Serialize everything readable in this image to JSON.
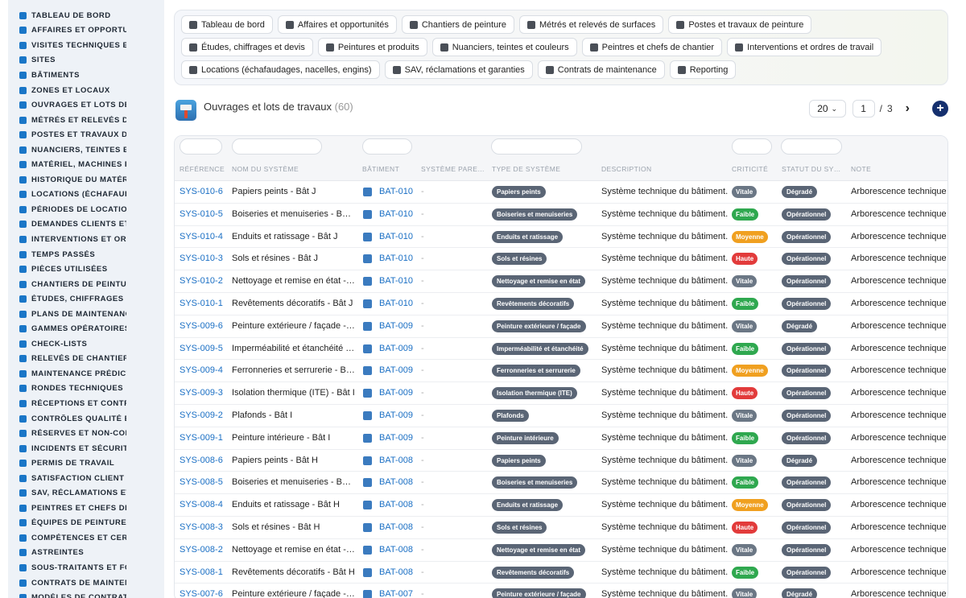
{
  "sidebar": {
    "items": [
      {
        "label": "TABLEAU DE BORD",
        "icon": "dashboard-icon"
      },
      {
        "label": "AFFAIRES ET OPPORTUNITÉS",
        "icon": "target-icon"
      },
      {
        "label": "VISITES TECHNIQUES ET",
        "icon": "clipboard-icon"
      },
      {
        "label": "SITES",
        "icon": "map-pin-icon"
      },
      {
        "label": "BÂTIMENTS",
        "icon": "building-icon"
      },
      {
        "label": "ZONES ET LOCAUX",
        "icon": "layers-icon"
      },
      {
        "label": "OUVRAGES ET LOTS DE TRAVAUX",
        "icon": "sitemap-icon"
      },
      {
        "label": "MÉTRÉS ET RELEVÉS DE",
        "icon": "ruler-icon"
      },
      {
        "label": "POSTES ET TRAVAUX DE",
        "icon": "paint-roller-icon"
      },
      {
        "label": "NUANCIERS, TEINTES ET",
        "icon": "palette-icon"
      },
      {
        "label": "MATÉRIEL, MACHINES ET",
        "icon": "gears-icon"
      },
      {
        "label": "HISTORIQUE DU MATÉRIEL",
        "icon": "history-icon"
      },
      {
        "label": "LOCATIONS (ÉCHAFAUDAGES",
        "icon": "truck-icon"
      },
      {
        "label": "PÉRIODES DE LOCATION",
        "icon": "calendar-icon"
      },
      {
        "label": "DEMANDES CLIENTS ET I",
        "icon": "file-icon"
      },
      {
        "label": "INTERVENTIONS ET ORDRES",
        "icon": "clipboard-check-icon"
      },
      {
        "label": "TEMPS PASSÉS",
        "icon": "clock-icon"
      },
      {
        "label": "PIÈCES UTILISÉES",
        "icon": "puzzle-icon"
      },
      {
        "label": "CHANTIERS DE PEINTURE",
        "icon": "brush-icon"
      },
      {
        "label": "ÉTUDES, CHIFFRAGES ET",
        "icon": "compass-icon"
      },
      {
        "label": "PLANS DE MAINTENANCE",
        "icon": "calendar-check-icon"
      },
      {
        "label": "GAMMES OPÉRATOIRES",
        "icon": "list-icon"
      },
      {
        "label": "CHECK-LISTS",
        "icon": "checklist-icon"
      },
      {
        "label": "RELEVÉS DE CHANTIER",
        "icon": "clipboard-list-icon"
      },
      {
        "label": "MAINTENANCE PRÉDICTIVE",
        "icon": "chart-line-icon"
      },
      {
        "label": "RONDES TECHNIQUES",
        "icon": "route-icon"
      },
      {
        "label": "RÉCEPTIONS ET CONTRÔLES",
        "icon": "search-icon"
      },
      {
        "label": "CONTRÔLES QUALITÉ ET",
        "icon": "check-square-icon"
      },
      {
        "label": "RÉSERVES ET NON-CONFORMITÉS",
        "icon": "alert-icon"
      },
      {
        "label": "INCIDENTS ET SÉCURITÉ",
        "icon": "warning-icon"
      },
      {
        "label": "PERMIS DE TRAVAIL",
        "icon": "pen-icon"
      },
      {
        "label": "SATISFACTION CLIENT",
        "icon": "smile-icon"
      },
      {
        "label": "SAV, RÉCLAMATIONS ET G",
        "icon": "comment-icon"
      },
      {
        "label": "PEINTRES ET CHEFS DE C",
        "icon": "users-icon"
      },
      {
        "label": "ÉQUIPES DE PEINTURE",
        "icon": "team-icon"
      },
      {
        "label": "COMPÉTENCES ET CERTIFICATIONS",
        "icon": "certificate-icon"
      },
      {
        "label": "ASTREINTES",
        "icon": "phone-icon"
      },
      {
        "label": "SOUS-TRAITANTS ET FOURNISSEURS",
        "icon": "handshake-icon"
      },
      {
        "label": "CONTRATS DE MAINTENANCE",
        "icon": "contract-icon"
      },
      {
        "label": "MODÈLES DE CONTRATS",
        "icon": "copy-icon"
      }
    ]
  },
  "nav": {
    "chips": [
      {
        "label": "Tableau de bord",
        "icon": "dashboard-icon"
      },
      {
        "label": "Affaires et opportunités",
        "icon": "target-icon"
      },
      {
        "label": "Chantiers de peinture",
        "icon": "brush-icon"
      },
      {
        "label": "Métrés et relevés de surfaces",
        "icon": "ruler-icon"
      },
      {
        "label": "Postes et travaux de peinture",
        "icon": "paint-roller-icon"
      },
      {
        "label": "Études, chiffrages et devis",
        "icon": "compass-icon"
      },
      {
        "label": "Peintures et produits",
        "icon": "paint-bucket-icon"
      },
      {
        "label": "Nuanciers, teintes et couleurs",
        "icon": "palette-icon"
      },
      {
        "label": "Peintres et chefs de chantier",
        "icon": "helmet-icon"
      },
      {
        "label": "Interventions et ordres de travail",
        "icon": "clipboard-check-icon"
      },
      {
        "label": "Locations (échafaudages, nacelles, engins)",
        "icon": "truck-icon"
      },
      {
        "label": "SAV, réclamations et garanties",
        "icon": "comment-icon"
      },
      {
        "label": "Contrats de maintenance",
        "icon": "contract-icon"
      },
      {
        "label": "Reporting",
        "icon": "chart-pie-icon"
      }
    ]
  },
  "header": {
    "title": "Ouvrages et lots de travaux",
    "count": "(60)",
    "page_size": "20",
    "page_current": "1",
    "page_sep": "/",
    "page_total": "3",
    "next_label": "›",
    "add_label": "+"
  },
  "table": {
    "columns": [
      "RÉFÉRENCE",
      "NOM DU SYSTÈME",
      "BÂTIMENT",
      "SYSTÈME PARE…",
      "TYPE DE SYSTÈME",
      "DESCRIPTION",
      "CRITICITÉ",
      "STATUT DU SY…",
      "NOTE"
    ],
    "rows": [
      {
        "ref": "SYS-010-6",
        "name": "Papiers peints - Bât J",
        "bat": "BAT-010",
        "parent": "-",
        "type": "Papiers peints",
        "desc": "Système technique du bâtiment.",
        "crit": "Vitale",
        "status": "Dégradé",
        "note": "Arborescence technique -"
      },
      {
        "ref": "SYS-010-5",
        "name": "Boiseries et menuiseries - Bât J",
        "bat": "BAT-010",
        "parent": "-",
        "type": "Boiseries et menuiseries",
        "desc": "Système technique du bâtiment.",
        "crit": "Faible",
        "status": "Opérationnel",
        "note": "Arborescence technique -"
      },
      {
        "ref": "SYS-010-4",
        "name": "Enduits et ratissage - Bât J",
        "bat": "BAT-010",
        "parent": "-",
        "type": "Enduits et ratissage",
        "desc": "Système technique du bâtiment.",
        "crit": "Moyenne",
        "status": "Opérationnel",
        "note": "Arborescence technique -"
      },
      {
        "ref": "SYS-010-3",
        "name": "Sols et résines - Bât J",
        "bat": "BAT-010",
        "parent": "-",
        "type": "Sols et résines",
        "desc": "Système technique du bâtiment.",
        "crit": "Haute",
        "status": "Opérationnel",
        "note": "Arborescence technique -"
      },
      {
        "ref": "SYS-010-2",
        "name": "Nettoyage et remise en état - …",
        "bat": "BAT-010",
        "parent": "-",
        "type": "Nettoyage et remise en état",
        "desc": "Système technique du bâtiment.",
        "crit": "Vitale",
        "status": "Opérationnel",
        "note": "Arborescence technique -"
      },
      {
        "ref": "SYS-010-1",
        "name": "Revêtements décoratifs - Bât J",
        "bat": "BAT-010",
        "parent": "-",
        "type": "Revêtements décoratifs",
        "desc": "Système technique du bâtiment.",
        "crit": "Faible",
        "status": "Opérationnel",
        "note": "Arborescence technique -"
      },
      {
        "ref": "SYS-009-6",
        "name": "Peinture extérieure / façade - …",
        "bat": "BAT-009",
        "parent": "-",
        "type": "Peinture extérieure / façade",
        "desc": "Système technique du bâtiment.",
        "crit": "Vitale",
        "status": "Dégradé",
        "note": "Arborescence technique -"
      },
      {
        "ref": "SYS-009-5",
        "name": "Imperméabilité et étanchéité -…",
        "bat": "BAT-009",
        "parent": "-",
        "type": "Imperméabilité et étanchéité",
        "desc": "Système technique du bâtiment.",
        "crit": "Faible",
        "status": "Opérationnel",
        "note": "Arborescence technique -"
      },
      {
        "ref": "SYS-009-4",
        "name": "Ferronneries et serrurerie - Bât I",
        "bat": "BAT-009",
        "parent": "-",
        "type": "Ferronneries et serrurerie",
        "desc": "Système technique du bâtiment.",
        "crit": "Moyenne",
        "status": "Opérationnel",
        "note": "Arborescence technique -"
      },
      {
        "ref": "SYS-009-3",
        "name": "Isolation thermique (ITE) - Bât I",
        "bat": "BAT-009",
        "parent": "-",
        "type": "Isolation thermique (ITE)",
        "desc": "Système technique du bâtiment.",
        "crit": "Haute",
        "status": "Opérationnel",
        "note": "Arborescence technique -"
      },
      {
        "ref": "SYS-009-2",
        "name": "Plafonds - Bât I",
        "bat": "BAT-009",
        "parent": "-",
        "type": "Plafonds",
        "desc": "Système technique du bâtiment.",
        "crit": "Vitale",
        "status": "Opérationnel",
        "note": "Arborescence technique -"
      },
      {
        "ref": "SYS-009-1",
        "name": "Peinture intérieure - Bât I",
        "bat": "BAT-009",
        "parent": "-",
        "type": "Peinture intérieure",
        "desc": "Système technique du bâtiment.",
        "crit": "Faible",
        "status": "Opérationnel",
        "note": "Arborescence technique -"
      },
      {
        "ref": "SYS-008-6",
        "name": "Papiers peints - Bât H",
        "bat": "BAT-008",
        "parent": "-",
        "type": "Papiers peints",
        "desc": "Système technique du bâtiment.",
        "crit": "Vitale",
        "status": "Dégradé",
        "note": "Arborescence technique -"
      },
      {
        "ref": "SYS-008-5",
        "name": "Boiseries et menuiseries - Bât H",
        "bat": "BAT-008",
        "parent": "-",
        "type": "Boiseries et menuiseries",
        "desc": "Système technique du bâtiment.",
        "crit": "Faible",
        "status": "Opérationnel",
        "note": "Arborescence technique -"
      },
      {
        "ref": "SYS-008-4",
        "name": "Enduits et ratissage - Bât H",
        "bat": "BAT-008",
        "parent": "-",
        "type": "Enduits et ratissage",
        "desc": "Système technique du bâtiment.",
        "crit": "Moyenne",
        "status": "Opérationnel",
        "note": "Arborescence technique -"
      },
      {
        "ref": "SYS-008-3",
        "name": "Sols et résines - Bât H",
        "bat": "BAT-008",
        "parent": "-",
        "type": "Sols et résines",
        "desc": "Système technique du bâtiment.",
        "crit": "Haute",
        "status": "Opérationnel",
        "note": "Arborescence technique -"
      },
      {
        "ref": "SYS-008-2",
        "name": "Nettoyage et remise en état - …",
        "bat": "BAT-008",
        "parent": "-",
        "type": "Nettoyage et remise en état",
        "desc": "Système technique du bâtiment.",
        "crit": "Vitale",
        "status": "Opérationnel",
        "note": "Arborescence technique -"
      },
      {
        "ref": "SYS-008-1",
        "name": "Revêtements décoratifs - Bât H",
        "bat": "BAT-008",
        "parent": "-",
        "type": "Revêtements décoratifs",
        "desc": "Système technique du bâtiment.",
        "crit": "Faible",
        "status": "Opérationnel",
        "note": "Arborescence technique -"
      },
      {
        "ref": "SYS-007-6",
        "name": "Peinture extérieure / façade - …",
        "bat": "BAT-007",
        "parent": "-",
        "type": "Peinture extérieure / façade",
        "desc": "Système technique du bâtiment.",
        "crit": "Vitale",
        "status": "Dégradé",
        "note": "Arborescence technique -"
      }
    ]
  },
  "colors": {
    "link": "#1a6fc4",
    "badge_gray": "#5a6575",
    "crit_vitale": "#6b7785",
    "crit_faible": "#2fa84f",
    "crit_moyenne": "#f0a020",
    "crit_haute": "#e23b3b",
    "add_button": "#15306e"
  }
}
